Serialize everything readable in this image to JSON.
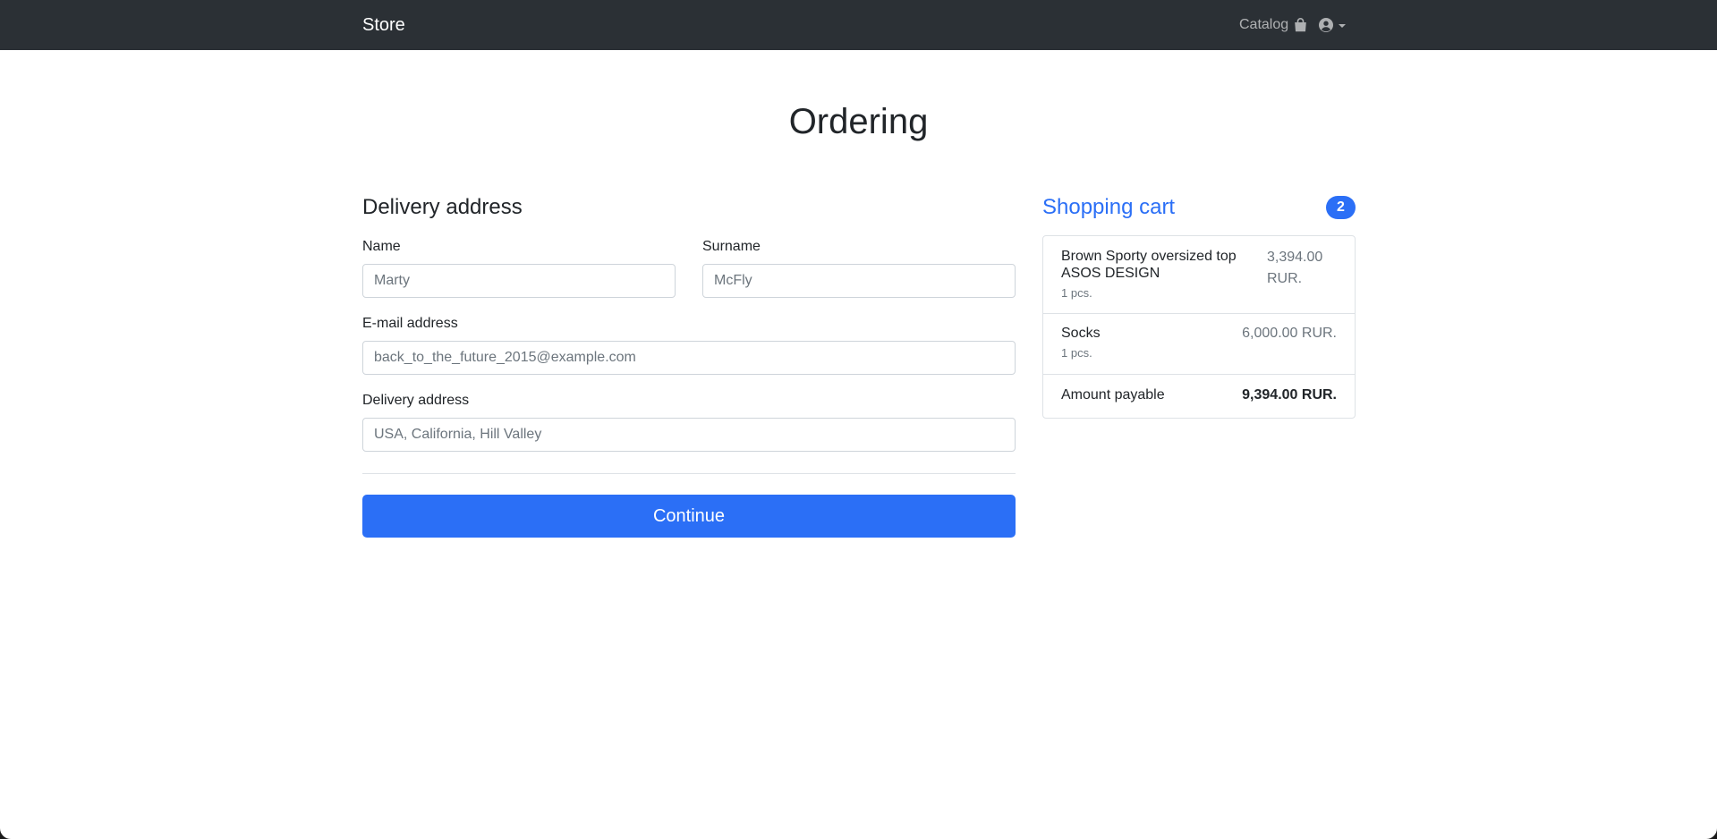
{
  "nav": {
    "brand": "Store",
    "catalog_label": "Catalog"
  },
  "page": {
    "title": "Ordering"
  },
  "form": {
    "section_title": "Delivery address",
    "name_label": "Name",
    "name_placeholder": "Marty",
    "surname_label": "Surname",
    "surname_placeholder": "McFly",
    "email_label": "E-mail address",
    "email_placeholder": "back_to_the_future_2015@example.com",
    "address_label": "Delivery address",
    "address_placeholder": "USA, California, Hill Valley",
    "continue_label": "Continue"
  },
  "cart": {
    "title": "Shopping cart",
    "count": "2",
    "items": [
      {
        "name_line1": "Brown Sporty oversized top",
        "name_line2": "ASOS DESIGN",
        "qty": "1 pcs.",
        "price_line1": "3,394.00",
        "price_line2": "RUR."
      },
      {
        "name_line1": "Socks",
        "qty": "1 pcs.",
        "price_line1": "6,000.00 RUR."
      }
    ],
    "total_label": "Amount payable",
    "total_value": "9,394.00 RUR."
  },
  "colors": {
    "navbar": "#2b3035",
    "primary": "#2b6ff6"
  }
}
